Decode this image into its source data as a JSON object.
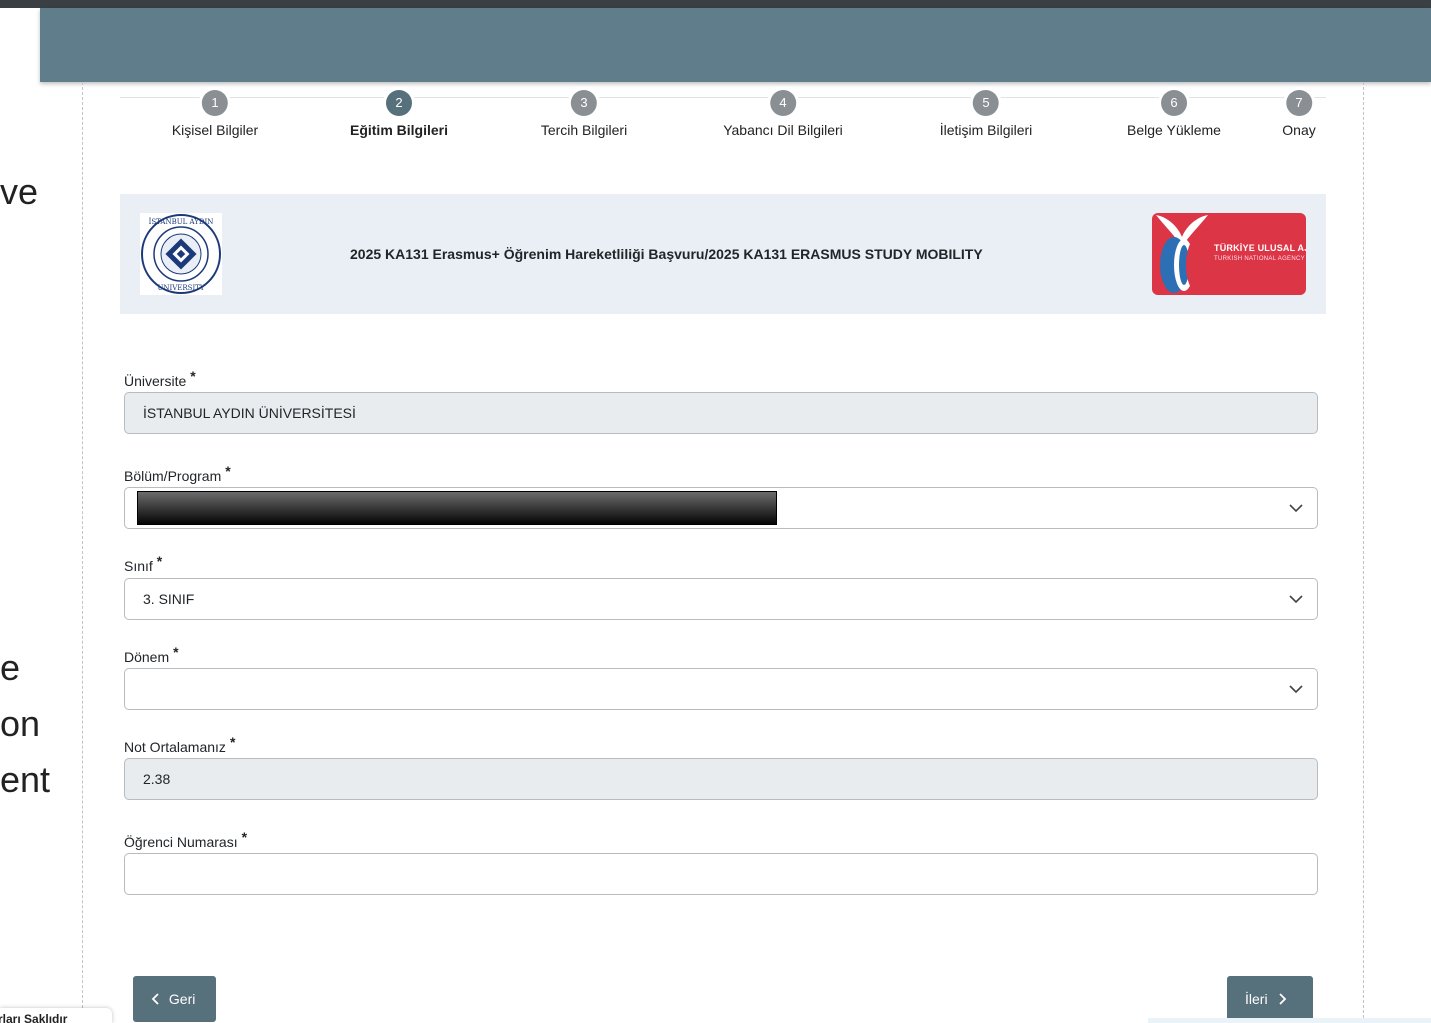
{
  "steps": [
    {
      "number": "1",
      "label": "Kişisel Bilgiler",
      "active": false
    },
    {
      "number": "2",
      "label": "Eğitim Bilgileri",
      "active": true
    },
    {
      "number": "3",
      "label": "Tercih Bilgileri",
      "active": false
    },
    {
      "number": "4",
      "label": "Yabancı Dil Bilgileri",
      "active": false
    },
    {
      "number": "5",
      "label": "İletişim Bilgileri",
      "active": false
    },
    {
      "number": "6",
      "label": "Belge Yükleme",
      "active": false
    },
    {
      "number": "7",
      "label": "Onay",
      "active": false
    }
  ],
  "left_fragments": [
    "ve",
    "e",
    "on",
    "ent"
  ],
  "banner": {
    "title": "2025 KA131 Erasmus+ Öğrenim Hareketliliği Başvuru/2025 KA131 ERASMUS STUDY MOBILITY",
    "uni_logo_text": "İSTANBUL AYDIN UNIVERSITY",
    "agency_logo_line1": "TÜRKİYE ULUSAL AJANSI",
    "agency_logo_line2": "TURKISH NATIONAL AGENCY"
  },
  "form": {
    "required_mark": "*",
    "universite": {
      "label": "Üniversite",
      "value": "İSTANBUL AYDIN ÜNİVERSİTESİ"
    },
    "bolum": {
      "label": "Bölüm/Program",
      "value": ""
    },
    "sinif": {
      "label": "Sınıf",
      "value": "3. SINIF"
    },
    "donem": {
      "label": "Dönem",
      "value": ""
    },
    "not_ortalamasi": {
      "label": "Not Ortalamanız",
      "value": "2.38"
    },
    "ogrenci_no": {
      "label": "Öğrenci Numarası",
      "value": ""
    }
  },
  "buttons": {
    "back": "Geri",
    "next": "İleri"
  },
  "cookie_notice": "rları Saklıdır",
  "colors": {
    "header": "#607d8b",
    "button": "#56707c",
    "banner_bg": "#e9eff4",
    "agency_red": "#dc3545"
  }
}
